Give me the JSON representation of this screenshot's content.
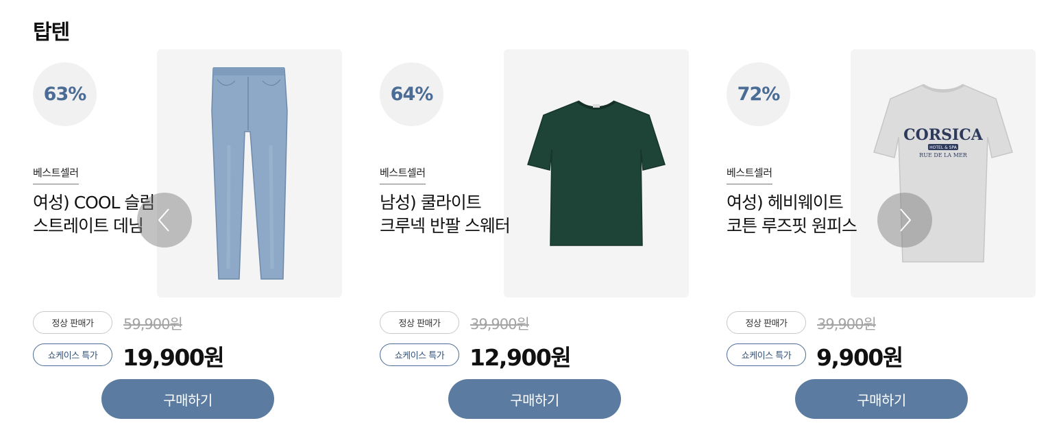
{
  "section": {
    "title": "탑텐"
  },
  "products": [
    {
      "discount": "63%",
      "badge": "베스트셀러",
      "name_line1": "여성) COOL 슬림",
      "name_line2": "스트레이트 데님",
      "normal_label": "정상 판매가",
      "original_price": "59,900원",
      "special_label": "쇼케이스 특가",
      "sale_price": "19,900원",
      "buy_label": "구매하기",
      "image_icon": "jeans-image"
    },
    {
      "discount": "64%",
      "badge": "베스트셀러",
      "name_line1": "남성) 쿨라이트",
      "name_line2": "크루넥 반팔 스웨터",
      "normal_label": "정상 판매가",
      "original_price": "39,900원",
      "special_label": "쇼케이스 특가",
      "sale_price": "12,900원",
      "buy_label": "구매하기",
      "image_icon": "green-tshirt-image"
    },
    {
      "discount": "72%",
      "badge": "베스트셀러",
      "name_line1": "여성) 헤비웨이트",
      "name_line2": "코튼 루즈핏 원피스",
      "normal_label": "정상 판매가",
      "original_price": "39,900원",
      "special_label": "쇼케이스 특가",
      "sale_price": "9,900원",
      "buy_label": "구매하기",
      "image_icon": "grey-tshirt-dress-image",
      "print_text": "CORSICA",
      "print_sub1": "HOTEL & SPA",
      "print_sub2": "RUE DE LA MER"
    }
  ],
  "carousel": {
    "prev_icon": "chevron-left-icon",
    "next_icon": "chevron-right-icon"
  },
  "colors": {
    "accent": "#5b7ba0",
    "discount_text": "#4a6c95",
    "image_bg": "#f4f4f4"
  }
}
